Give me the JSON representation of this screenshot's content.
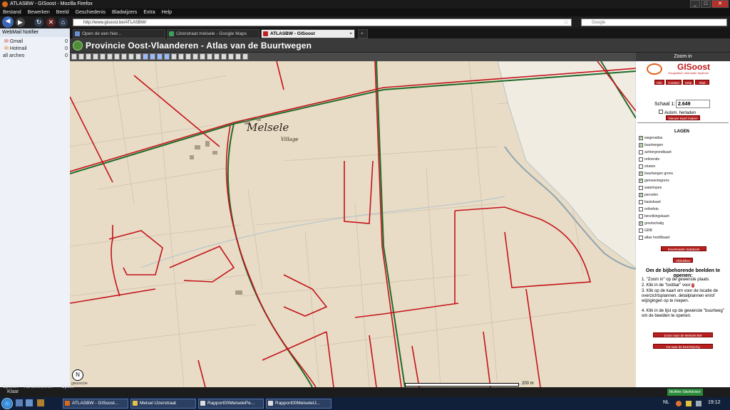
{
  "window": {
    "title": "ATLASBW - GISoost - Mozilla Firefox"
  },
  "menu": [
    "Bestand",
    "Bewerken",
    "Beeld",
    "Geschiedenis",
    "Bladwijzers",
    "Extra",
    "Help"
  ],
  "nav": {
    "url": "http://www.gisoost.be/ATLASBW/",
    "search_placeholder": "Google"
  },
  "sidebar": {
    "header": "WebMail Notifier",
    "items": [
      {
        "label": "Gmail",
        "count": "0"
      },
      {
        "label": "Hotmail",
        "count": "0"
      },
      {
        "label": "all archeo",
        "count": "0"
      }
    ]
  },
  "tabs": [
    {
      "label": "Open de een hier...",
      "active": false
    },
    {
      "label": "IJzerstraat melsele - Google Maps",
      "active": false
    },
    {
      "label": "ATLASBW - GISoost",
      "active": true
    }
  ],
  "page": {
    "title": "Provincie Oost-Vlaanderen - Atlas van de Buurtwegen",
    "zoom_label": "Zoom in"
  },
  "map": {
    "place_label": "Melsele",
    "sublabel": "Village",
    "scale_text": "200 m",
    "north_label": "N",
    "attribution": "gisoost.be"
  },
  "panel": {
    "logo_text": "GISoost",
    "logo_sub": "Geografisch Informatie Systeem",
    "top_buttons": [
      "Info",
      "Contact",
      "Help",
      "Sluit"
    ],
    "scale_label": "Schaal 1:",
    "scale_value": "2.649",
    "auto_label": "Autom. herladen",
    "reload_button": "Nieuwe kaart maken",
    "layers_title": "LAGEN",
    "layers": [
      {
        "label": "wegenatlas",
        "checked": true
      },
      {
        "label": "buurtwegen",
        "checked": true
      },
      {
        "label": "achtergrondkaart",
        "checked": false
      },
      {
        "label": "referentie",
        "checked": false
      },
      {
        "label": "straten",
        "checked": false
      },
      {
        "label": "buurtwegen grens",
        "checked": true
      },
      {
        "label": "gemeentegrens",
        "checked": true
      },
      {
        "label": "waterlopen",
        "checked": false
      },
      {
        "label": "percelen",
        "checked": true
      },
      {
        "label": "basiskaart",
        "checked": false
      },
      {
        "label": "orthofoto",
        "checked": false
      },
      {
        "label": "bevolkingskaart",
        "checked": false
      },
      {
        "label": "grootschalig",
        "checked": true
      },
      {
        "label": "GRB",
        "checked": false
      },
      {
        "label": "atlas hoofdkaart",
        "checked": false
      }
    ],
    "export_button": "Downloaden databank",
    "print_button": "Afdrukken",
    "instr_title": "Om de bijbehorende beelden te openen:",
    "instructions": [
      "\"Zoom in\" op de gewenste plaats",
      "Klik in de \"toolbar\" voor",
      "Klik op de kaart om voor de locatie de overzichtsplannen, detailplannen en/of wijzigingen op te roepen.",
      "Klik in de lijst op de gewenste \"buurtweg\" om de beelden te openen."
    ],
    "btn_bottom1": "Zoom naar de Melsele BW",
    "btn_bottom2": "Ga naar de beschrijving"
  },
  "status": {
    "text": "Klaar",
    "left_items": [
      "Openen",
      "Nu controleren",
      "Opties"
    ],
    "badge": "McAfee SiteAdvisor"
  },
  "taskbar": {
    "items": [
      "ATLASBW - GISoost...",
      "Melsel IJzerstraat",
      "Rapport00MelselePe...",
      "Rapport00MelseleIJ..."
    ],
    "lang": "NL",
    "time": "19:12"
  },
  "colors": {
    "road_red": "#c4121a",
    "road_green": "#1f6b2a",
    "map_bg": "#e8dcc6",
    "water": "#b7c3c9"
  }
}
